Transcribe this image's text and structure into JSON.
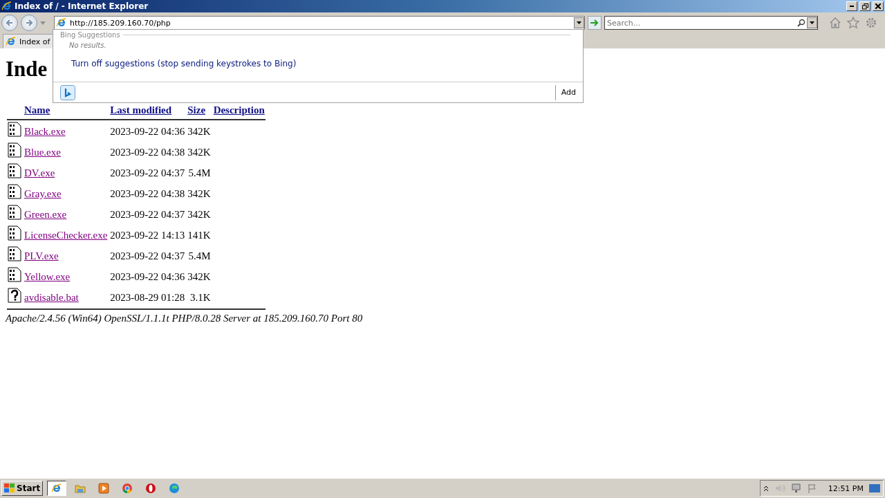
{
  "window": {
    "title": "Index of / - Internet Explorer"
  },
  "address": {
    "value": "http://185.209.160.70/php"
  },
  "search": {
    "placeholder": "Search..."
  },
  "tab": {
    "label": "Index of"
  },
  "suggestions": {
    "heading": "Bing Suggestions",
    "empty": "No results.",
    "turn_off": "Turn off suggestions (stop sending keystrokes to Bing)",
    "add": "Add"
  },
  "page": {
    "heading": "Inde",
    "columns": [
      "Name",
      "Last modified",
      "Size",
      "Description"
    ],
    "rows": [
      {
        "name": "Black.exe",
        "modified": "2023-09-22 04:36",
        "size": "342K",
        "kind": "binary"
      },
      {
        "name": "Blue.exe",
        "modified": "2023-09-22 04:38",
        "size": "342K",
        "kind": "binary"
      },
      {
        "name": "DV.exe",
        "modified": "2023-09-22 04:37",
        "size": "5.4M",
        "kind": "binary"
      },
      {
        "name": "Gray.exe",
        "modified": "2023-09-22 04:38",
        "size": "342K",
        "kind": "binary"
      },
      {
        "name": "Green.exe",
        "modified": "2023-09-22 04:37",
        "size": "342K",
        "kind": "binary"
      },
      {
        "name": "LicenseChecker.exe",
        "modified": "2023-09-22 14:13",
        "size": "141K",
        "kind": "binary"
      },
      {
        "name": "PLV.exe",
        "modified": "2023-09-22 04:37",
        "size": "5.4M",
        "kind": "binary"
      },
      {
        "name": "Yellow.exe",
        "modified": "2023-09-22 04:36",
        "size": "342K",
        "kind": "binary"
      },
      {
        "name": "avdisable.bat",
        "modified": "2023-08-29 01:28",
        "size": "3.1K",
        "kind": "unknown"
      }
    ],
    "footer": "Apache/2.4.56 (Win64) OpenSSL/1.1.1t PHP/8.0.28 Server at 185.209.160.70 Port 80"
  },
  "taskbar": {
    "start": "Start",
    "apps": [
      {
        "kind": "ie",
        "selected": true
      },
      {
        "kind": "folder",
        "selected": false
      },
      {
        "kind": "media",
        "selected": false
      },
      {
        "kind": "chrome",
        "selected": false
      },
      {
        "kind": "opera",
        "selected": false
      },
      {
        "kind": "edge",
        "selected": false
      }
    ],
    "clock": "12:51 PM"
  }
}
